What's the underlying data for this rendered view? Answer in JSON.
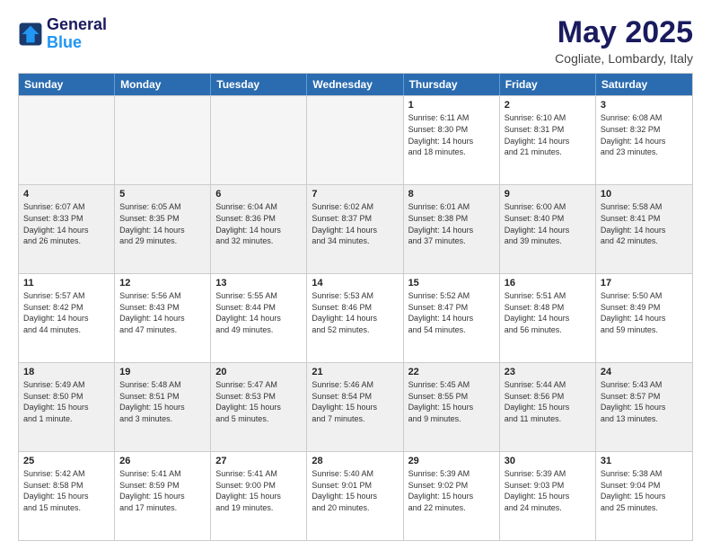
{
  "header": {
    "logo_line1": "General",
    "logo_line2": "Blue",
    "month_title": "May 2025",
    "location": "Cogliate, Lombardy, Italy"
  },
  "weekdays": [
    "Sunday",
    "Monday",
    "Tuesday",
    "Wednesday",
    "Thursday",
    "Friday",
    "Saturday"
  ],
  "weeks": [
    [
      {
        "day": "",
        "info": ""
      },
      {
        "day": "",
        "info": ""
      },
      {
        "day": "",
        "info": ""
      },
      {
        "day": "",
        "info": ""
      },
      {
        "day": "1",
        "info": "Sunrise: 6:11 AM\nSunset: 8:30 PM\nDaylight: 14 hours\nand 18 minutes."
      },
      {
        "day": "2",
        "info": "Sunrise: 6:10 AM\nSunset: 8:31 PM\nDaylight: 14 hours\nand 21 minutes."
      },
      {
        "day": "3",
        "info": "Sunrise: 6:08 AM\nSunset: 8:32 PM\nDaylight: 14 hours\nand 23 minutes."
      }
    ],
    [
      {
        "day": "4",
        "info": "Sunrise: 6:07 AM\nSunset: 8:33 PM\nDaylight: 14 hours\nand 26 minutes."
      },
      {
        "day": "5",
        "info": "Sunrise: 6:05 AM\nSunset: 8:35 PM\nDaylight: 14 hours\nand 29 minutes."
      },
      {
        "day": "6",
        "info": "Sunrise: 6:04 AM\nSunset: 8:36 PM\nDaylight: 14 hours\nand 32 minutes."
      },
      {
        "day": "7",
        "info": "Sunrise: 6:02 AM\nSunset: 8:37 PM\nDaylight: 14 hours\nand 34 minutes."
      },
      {
        "day": "8",
        "info": "Sunrise: 6:01 AM\nSunset: 8:38 PM\nDaylight: 14 hours\nand 37 minutes."
      },
      {
        "day": "9",
        "info": "Sunrise: 6:00 AM\nSunset: 8:40 PM\nDaylight: 14 hours\nand 39 minutes."
      },
      {
        "day": "10",
        "info": "Sunrise: 5:58 AM\nSunset: 8:41 PM\nDaylight: 14 hours\nand 42 minutes."
      }
    ],
    [
      {
        "day": "11",
        "info": "Sunrise: 5:57 AM\nSunset: 8:42 PM\nDaylight: 14 hours\nand 44 minutes."
      },
      {
        "day": "12",
        "info": "Sunrise: 5:56 AM\nSunset: 8:43 PM\nDaylight: 14 hours\nand 47 minutes."
      },
      {
        "day": "13",
        "info": "Sunrise: 5:55 AM\nSunset: 8:44 PM\nDaylight: 14 hours\nand 49 minutes."
      },
      {
        "day": "14",
        "info": "Sunrise: 5:53 AM\nSunset: 8:46 PM\nDaylight: 14 hours\nand 52 minutes."
      },
      {
        "day": "15",
        "info": "Sunrise: 5:52 AM\nSunset: 8:47 PM\nDaylight: 14 hours\nand 54 minutes."
      },
      {
        "day": "16",
        "info": "Sunrise: 5:51 AM\nSunset: 8:48 PM\nDaylight: 14 hours\nand 56 minutes."
      },
      {
        "day": "17",
        "info": "Sunrise: 5:50 AM\nSunset: 8:49 PM\nDaylight: 14 hours\nand 59 minutes."
      }
    ],
    [
      {
        "day": "18",
        "info": "Sunrise: 5:49 AM\nSunset: 8:50 PM\nDaylight: 15 hours\nand 1 minute."
      },
      {
        "day": "19",
        "info": "Sunrise: 5:48 AM\nSunset: 8:51 PM\nDaylight: 15 hours\nand 3 minutes."
      },
      {
        "day": "20",
        "info": "Sunrise: 5:47 AM\nSunset: 8:53 PM\nDaylight: 15 hours\nand 5 minutes."
      },
      {
        "day": "21",
        "info": "Sunrise: 5:46 AM\nSunset: 8:54 PM\nDaylight: 15 hours\nand 7 minutes."
      },
      {
        "day": "22",
        "info": "Sunrise: 5:45 AM\nSunset: 8:55 PM\nDaylight: 15 hours\nand 9 minutes."
      },
      {
        "day": "23",
        "info": "Sunrise: 5:44 AM\nSunset: 8:56 PM\nDaylight: 15 hours\nand 11 minutes."
      },
      {
        "day": "24",
        "info": "Sunrise: 5:43 AM\nSunset: 8:57 PM\nDaylight: 15 hours\nand 13 minutes."
      }
    ],
    [
      {
        "day": "25",
        "info": "Sunrise: 5:42 AM\nSunset: 8:58 PM\nDaylight: 15 hours\nand 15 minutes."
      },
      {
        "day": "26",
        "info": "Sunrise: 5:41 AM\nSunset: 8:59 PM\nDaylight: 15 hours\nand 17 minutes."
      },
      {
        "day": "27",
        "info": "Sunrise: 5:41 AM\nSunset: 9:00 PM\nDaylight: 15 hours\nand 19 minutes."
      },
      {
        "day": "28",
        "info": "Sunrise: 5:40 AM\nSunset: 9:01 PM\nDaylight: 15 hours\nand 20 minutes."
      },
      {
        "day": "29",
        "info": "Sunrise: 5:39 AM\nSunset: 9:02 PM\nDaylight: 15 hours\nand 22 minutes."
      },
      {
        "day": "30",
        "info": "Sunrise: 5:39 AM\nSunset: 9:03 PM\nDaylight: 15 hours\nand 24 minutes."
      },
      {
        "day": "31",
        "info": "Sunrise: 5:38 AM\nSunset: 9:04 PM\nDaylight: 15 hours\nand 25 minutes."
      }
    ]
  ]
}
